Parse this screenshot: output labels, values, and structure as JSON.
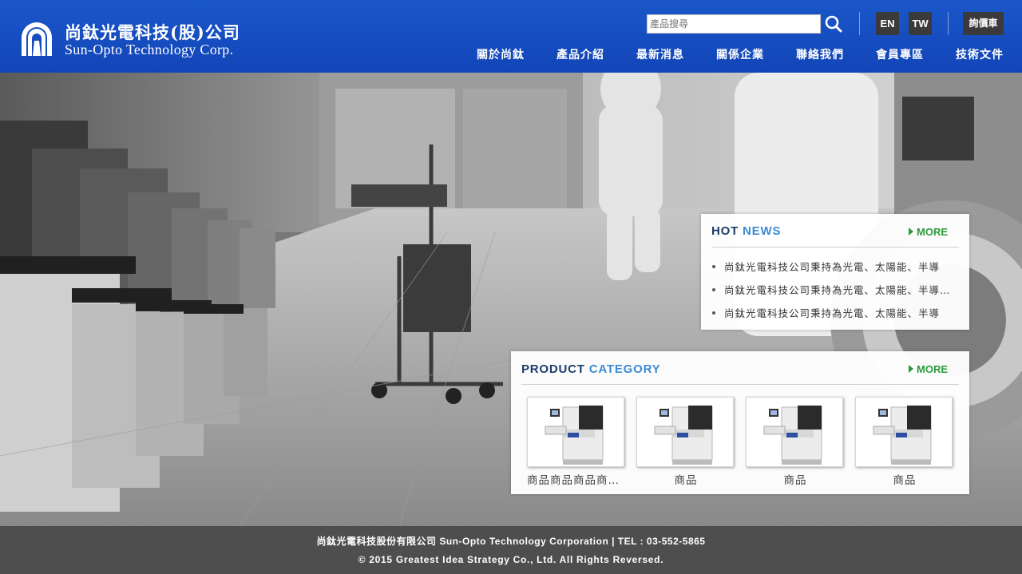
{
  "brand": {
    "name_zh": "尚鈦光電科技(股)公司",
    "name_en": "Sun-Opto Technology Corp.",
    "logo_icon": "sun-opto-logo-icon",
    "color": "#1a57c9"
  },
  "header": {
    "search_placeholder": "產品搜尋",
    "search_icon": "search-icon",
    "lang_en": "EN",
    "lang_tw": "TW",
    "cart_label": "詢價車"
  },
  "nav": [
    {
      "label": "關於尚鈦"
    },
    {
      "label": "產品介紹"
    },
    {
      "label": "最新消息"
    },
    {
      "label": "關係企業"
    },
    {
      "label": "聯絡我們"
    },
    {
      "label": "會員專區"
    },
    {
      "label": "技術文件"
    }
  ],
  "hot_news": {
    "title_part1": "HOT",
    "title_part2": "NEWS",
    "more_label": "MORE",
    "items": [
      {
        "text": "尚鈦光電科技公司秉持為光電、太陽能、半導"
      },
      {
        "text": "尚鈦光電科技公司秉持為光電、太陽能、半導體產業"
      },
      {
        "text": "尚鈦光電科技公司秉持為光電、太陽能、半導"
      }
    ]
  },
  "product_category": {
    "title_part1": "PRODUCT",
    "title_part2": "CATEGORY",
    "more_label": "MORE",
    "items": [
      {
        "name": "商品商品商品商品商品"
      },
      {
        "name": "商品"
      },
      {
        "name": "商品"
      },
      {
        "name": "商品"
      }
    ]
  },
  "footer": {
    "company_line": "尚鈦光電科技股份有限公司 Sun-Opto Technology Corporation | TEL : 03-552-5865",
    "copyright": "© 2015 Greatest Idea Strategy Co., Ltd. All Rights Reversed."
  },
  "colors": {
    "accent_green": "#2a9c3a",
    "title_dark_blue": "#1c3b6b",
    "title_light_blue": "#3a8bd6"
  }
}
